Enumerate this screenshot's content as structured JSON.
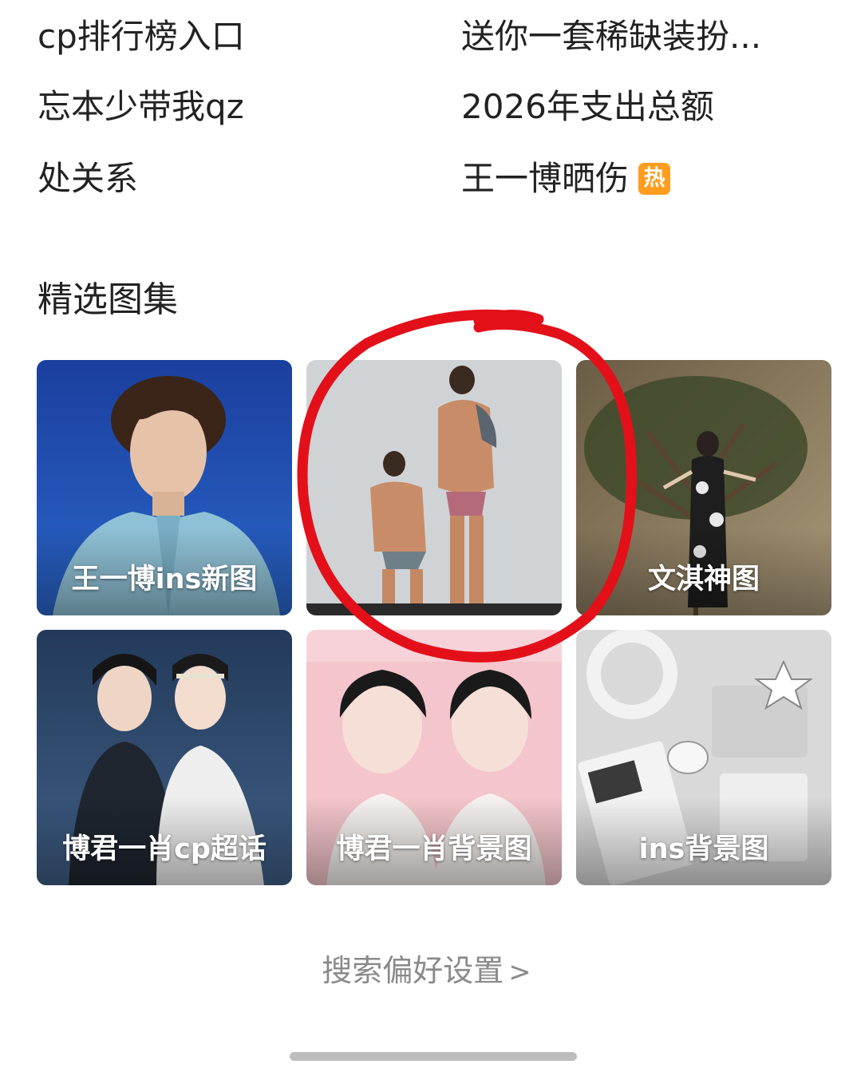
{
  "hot_searches": [
    {
      "label": "cp排行榜入口",
      "badge": ""
    },
    {
      "label": "送你一套稀缺装扮...",
      "badge": ""
    },
    {
      "label": "忘本少带我qz",
      "badge": ""
    },
    {
      "label": "2026年支出总额",
      "badge": ""
    },
    {
      "label": "处关系",
      "badge": ""
    },
    {
      "label": "王一博晒伤",
      "badge": "热"
    }
  ],
  "gallery": {
    "title": "精选图集",
    "tiles": [
      {
        "label": "王一博ins新图"
      },
      {
        "label": ""
      },
      {
        "label": "文淇神图"
      },
      {
        "label": "博君一肖cp超话"
      },
      {
        "label": "博君一肖背景图"
      },
      {
        "label": "ins背景图"
      }
    ]
  },
  "footer": {
    "search_prefs_label": "搜索偏好设置",
    "chevron": ">"
  },
  "colors": {
    "hot_badge": "#ff9d1e",
    "annotation_circle": "#e3101a"
  }
}
